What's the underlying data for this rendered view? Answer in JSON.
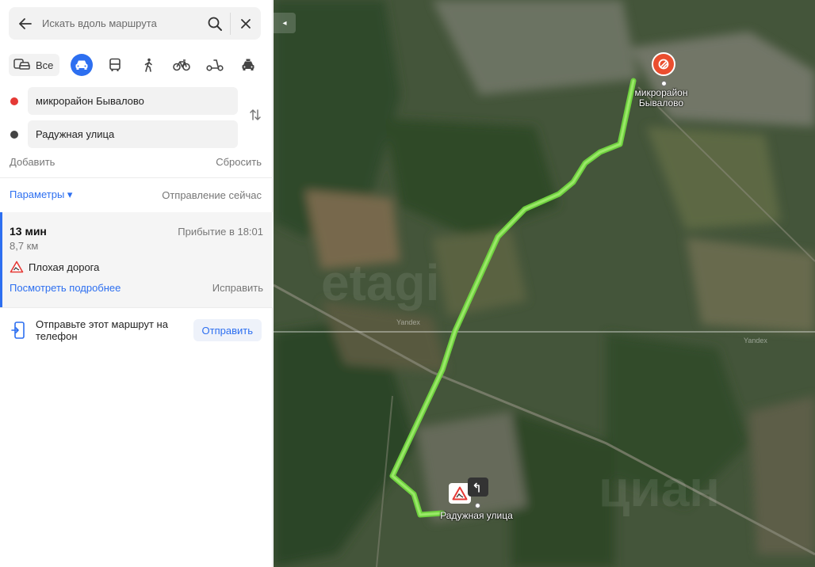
{
  "search": {
    "placeholder": "Искать вдоль маршрута"
  },
  "modes": {
    "all_label": "Все",
    "icons": [
      "car-icon",
      "bus-icon",
      "pedestrian-icon",
      "bicycle-icon",
      "scooter-icon",
      "taxi-icon"
    ],
    "active": "car-icon"
  },
  "route": {
    "from": "микрорайон Бывалово",
    "to": "Радужная улица",
    "add_label": "Добавить",
    "reset_label": "Сбросить",
    "params_label": "Параметры ▾",
    "departure_label": "Отправление сейчас"
  },
  "option": {
    "duration": "13 мин",
    "arrival": "Прибытие в 18:01",
    "distance": "8,7 км",
    "warning": "Плохая дорога",
    "details_link": "Посмотреть подробнее",
    "fix_label": "Исправить"
  },
  "send": {
    "text": "Отправьте этот маршрут на телефон",
    "button": "Отправить"
  },
  "map": {
    "start_label": "микрорайон Бывалово",
    "end_label": "Радужная улица",
    "watermark_1": "etagi",
    "watermark_2": "циан",
    "copyright": "Yandex",
    "route_color": "#7dd84a",
    "pin_color": "#ea4e2f"
  },
  "colors": {
    "accent": "#2d6ff0",
    "start_dot": "#e53935",
    "end_dot": "#444444"
  }
}
